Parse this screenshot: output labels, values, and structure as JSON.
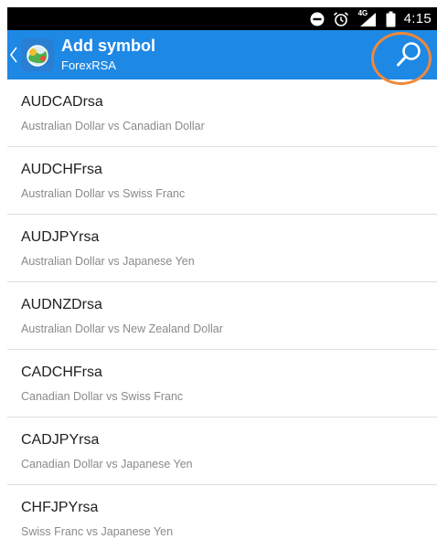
{
  "status_bar": {
    "time": "4:15",
    "network": "4G",
    "icons": [
      "do-not-disturb-icon",
      "alarm-icon",
      "signal-icon",
      "battery-icon"
    ]
  },
  "app_bar": {
    "title": "Add symbol",
    "subtitle": "ForexRSA",
    "color": "#1e88e5",
    "icons": [
      "back-chevron-icon",
      "app-logo-icon",
      "search-icon"
    ]
  },
  "highlight_color": "#f0883a",
  "symbols": [
    {
      "name": "AUDCADrsa",
      "description": "Australian Dollar vs Canadian Dollar"
    },
    {
      "name": "AUDCHFrsa",
      "description": "Australian Dollar vs Swiss Franc"
    },
    {
      "name": "AUDJPYrsa",
      "description": "Australian Dollar vs Japanese Yen"
    },
    {
      "name": "AUDNZDrsa",
      "description": "Australian Dollar vs New Zealand Dollar"
    },
    {
      "name": "CADCHFrsa",
      "description": "Canadian Dollar vs Swiss Franc"
    },
    {
      "name": "CADJPYrsa",
      "description": "Canadian Dollar vs Japanese Yen"
    },
    {
      "name": "CHFJPYrsa",
      "description": "Swiss Franc vs Japanese Yen"
    }
  ]
}
